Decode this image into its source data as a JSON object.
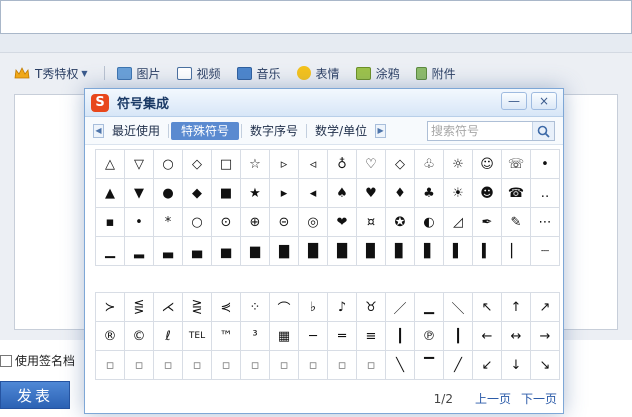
{
  "toolbar": {
    "items": [
      {
        "label": "T秀特权",
        "icon": "crown-icon"
      },
      {
        "label": "图片",
        "icon": "image-icon"
      },
      {
        "label": "视频",
        "icon": "video-icon"
      },
      {
        "label": "音乐",
        "icon": "music-icon"
      },
      {
        "label": "表情",
        "icon": "smiley-icon"
      },
      {
        "label": "涂鸦",
        "icon": "brush-icon"
      },
      {
        "label": "附件",
        "icon": "attachment-icon"
      }
    ]
  },
  "footer": {
    "signature_label": "使用签名档",
    "post_label": "发表"
  },
  "palette": {
    "title": "符号集成",
    "logo": "S",
    "min_symbol": "—",
    "close_symbol": "×",
    "tabs": [
      "最近使用",
      "特殊符号",
      "数字序号",
      "数学/单位"
    ],
    "active_tab": "特殊符号",
    "search_placeholder": "搜索符号",
    "rows_a": [
      [
        "△",
        "▽",
        "○",
        "◇",
        "□",
        "☆",
        "▹",
        "◃",
        "♁",
        "♡",
        "◇",
        "♧",
        "☼",
        "☺",
        "☏",
        "•"
      ],
      [
        "▲",
        "▼",
        "●",
        "◆",
        "■",
        "★",
        "▸",
        "◂",
        "♠",
        "♥",
        "♦",
        "♣",
        "☀",
        "☻",
        "☎",
        "‥"
      ],
      [
        "▪",
        "•",
        "*",
        "○",
        "⊙",
        "⊕",
        "⊝",
        "◎",
        "❤",
        "¤",
        "✪",
        "◐",
        "◿",
        "✒",
        "✎",
        "⋯"
      ],
      [
        "▁",
        "▂",
        "▃",
        "▄",
        "▅",
        "▆",
        "▇",
        "█",
        "█",
        "▉",
        "▊",
        "▋",
        "▌",
        "▍",
        "▏",
        "┈"
      ]
    ],
    "rows_b": [
      [
        "≻",
        "⋚",
        "⋌",
        "⋛",
        "⋞",
        "⁘",
        "⌒",
        "♭",
        "♪",
        "♉",
        "／",
        "▁",
        "＼",
        "↖",
        "↑",
        "↗"
      ],
      [
        "®",
        "©",
        "ℓ",
        "TEL",
        "™",
        "³",
        "▦",
        "─",
        "═",
        "≡",
        "┃",
        "℗",
        "┃",
        "←",
        "↔",
        "→"
      ],
      [
        "▫",
        "▫",
        "▫",
        "▫",
        "▫",
        "▫",
        "▫",
        "▫",
        "▫",
        "▫",
        "╲",
        "▔",
        "╱",
        "↙",
        "↓",
        "↘"
      ]
    ],
    "pager": {
      "count": "1/2",
      "prev": "上一页",
      "next": "下一页"
    }
  }
}
